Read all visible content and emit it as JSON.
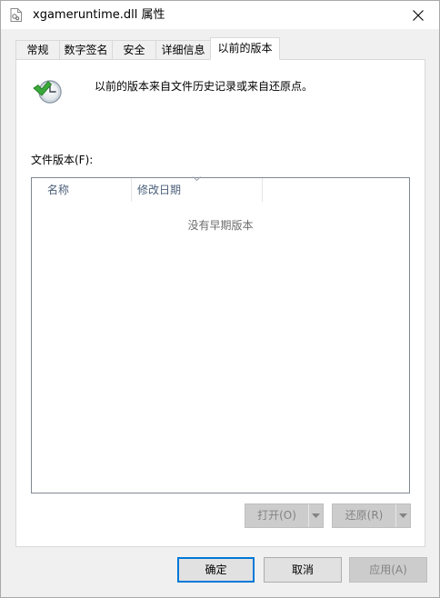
{
  "window": {
    "title": "xgameruntime.dll 属性",
    "close_label": "✕"
  },
  "tabs": [
    {
      "label": "常规",
      "active": false
    },
    {
      "label": "数字签名",
      "active": false
    },
    {
      "label": "安全",
      "active": false
    },
    {
      "label": "详细信息",
      "active": false
    },
    {
      "label": "以前的版本",
      "active": true
    }
  ],
  "panel": {
    "info_text": "以前的版本来自文件历史记录或来自还原点。",
    "versions_label": "文件版本(F):",
    "columns": [
      "名称",
      "修改日期"
    ],
    "empty_text": "没有早期版本",
    "open_button": "打开(O)",
    "restore_button": "还原(R)"
  },
  "footer": {
    "ok": "确定",
    "cancel": "取消",
    "apply": "应用(A)"
  },
  "colors": {
    "accent": "#0078d7",
    "header_text": "#4c607a",
    "disabled_text": "#838383"
  }
}
